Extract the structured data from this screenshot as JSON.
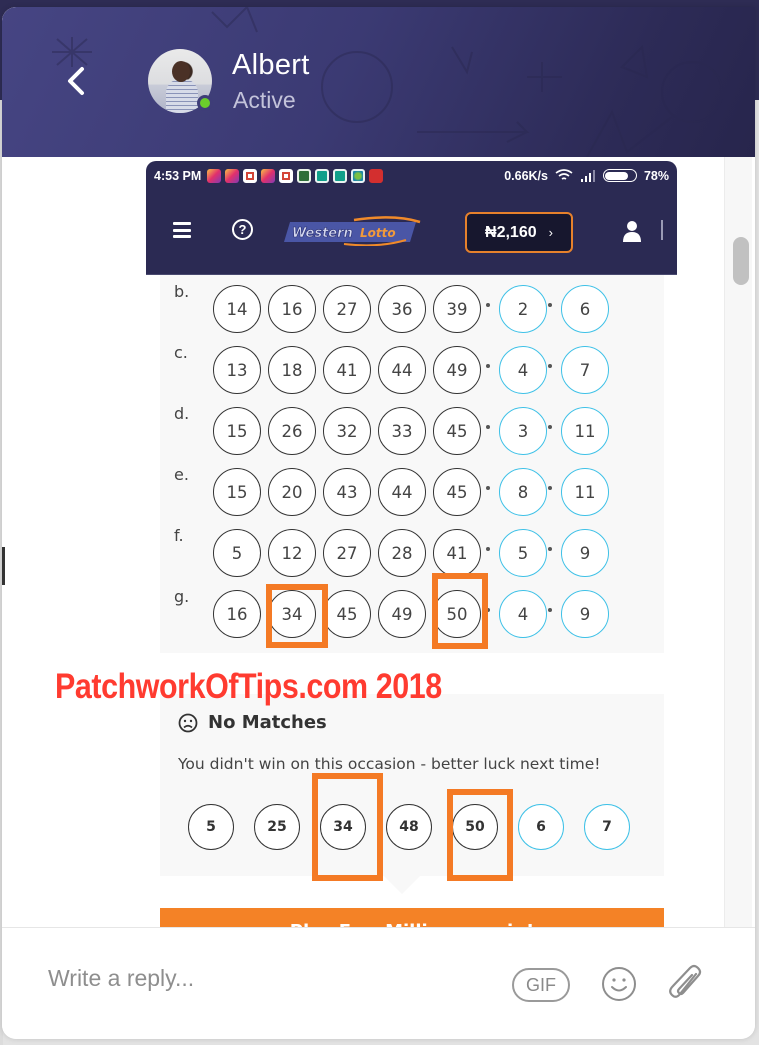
{
  "chat": {
    "contact_name": "Albert",
    "contact_status": "Active",
    "back_label": "<",
    "presence_color": "#6bcd2c"
  },
  "phone": {
    "status_bar": {
      "time": "4:53 PM",
      "notification_icons": [
        "instagram",
        "instagram",
        "gmail",
        "instagram",
        "gmail",
        "app-green",
        "app-teal",
        "app-teal",
        "app-globe",
        "app-red-more"
      ],
      "network_speed": "0.66K/s",
      "battery_percent": "78%",
      "battery_level": 0.78
    },
    "app_bar": {
      "brand": "WesternLotto",
      "brand_part1": "Western",
      "brand_part2": "Lotto",
      "balance": "₦2,160",
      "balance_chevron": "›",
      "help_glyph": "?"
    },
    "lines": [
      {
        "label": "b.",
        "main": [
          "14",
          "16",
          "27",
          "36",
          "39"
        ],
        "stars": [
          "2",
          "6"
        ]
      },
      {
        "label": "c.",
        "main": [
          "13",
          "18",
          "41",
          "44",
          "49"
        ],
        "stars": [
          "4",
          "7"
        ]
      },
      {
        "label": "d.",
        "main": [
          "15",
          "26",
          "32",
          "33",
          "45"
        ],
        "stars": [
          "3",
          "11"
        ]
      },
      {
        "label": "e.",
        "main": [
          "15",
          "20",
          "43",
          "44",
          "45"
        ],
        "stars": [
          "8",
          "11"
        ]
      },
      {
        "label": "f.",
        "main": [
          "5",
          "12",
          "27",
          "28",
          "41"
        ],
        "stars": [
          "5",
          "9"
        ]
      },
      {
        "label": "g.",
        "main": [
          "16",
          "34",
          "45",
          "49",
          "50"
        ],
        "stars": [
          "4",
          "9"
        ]
      }
    ],
    "result": {
      "title": "No Matches",
      "message": "You didn't win on this occasion - better luck next time!",
      "drawn_main": [
        "5",
        "25",
        "34",
        "48",
        "50"
      ],
      "drawn_stars": [
        "6",
        "7"
      ]
    },
    "play_again_label": "Play EuroMillions again!"
  },
  "watermark": "PatchworkOfTips.com 2018",
  "annotation_color": "#f47a25",
  "composer": {
    "placeholder": "Write a reply...",
    "gif_label": "GIF"
  }
}
